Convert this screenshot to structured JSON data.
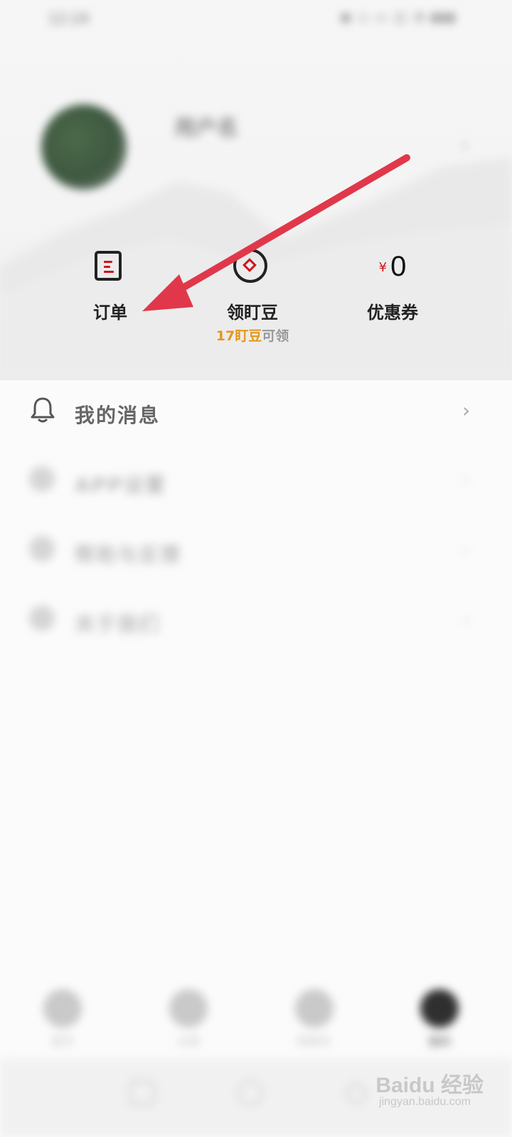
{
  "status": {
    "time": "12:24",
    "icons": "◉ ◇ ▭ ◫ ◔ ▮▮▮"
  },
  "profile": {
    "name": "用户名",
    "chevron": "›"
  },
  "quick_actions": {
    "orders": {
      "label": "订单"
    },
    "beans": {
      "label": "领盯豆",
      "count": "17盯豆",
      "suffix": "可领"
    },
    "coupons": {
      "label": "优惠券",
      "currency": "¥",
      "value": "0"
    }
  },
  "menu": {
    "messages": {
      "label": "我的消息",
      "icon": "bell-icon"
    },
    "item2": {
      "label": "APP设置"
    },
    "item3": {
      "label": "帮助与反馈"
    },
    "item4": {
      "label": "关于我们"
    },
    "chevron": "›"
  },
  "bottom_nav": {
    "tab1": {
      "label": "首页"
    },
    "tab2": {
      "label": "分类"
    },
    "tab3": {
      "label": "购物车"
    },
    "tab4": {
      "label": "我的"
    }
  },
  "watermark": {
    "brand": "Baidu 经验",
    "url": "jingyan.baidu.com"
  },
  "colors": {
    "accent_red": "#d0141c",
    "bean_orange": "#e69619",
    "arrow_red": "#e0384a"
  }
}
